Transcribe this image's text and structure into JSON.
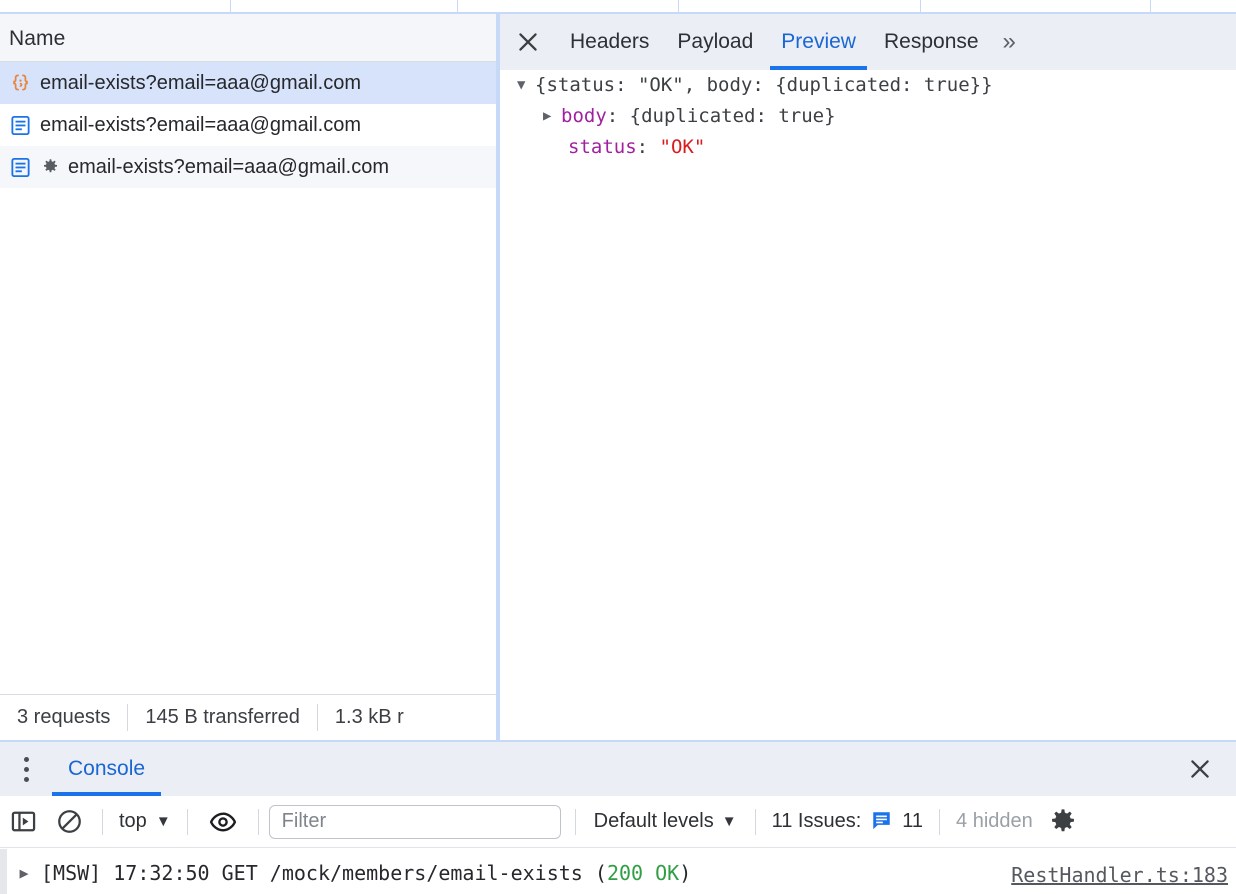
{
  "network": {
    "column_header": "Name",
    "requests": [
      {
        "icon": "json-braces-icon",
        "name": "email-exists?email=aaa@gmail.com",
        "selected": true,
        "has_gear": false
      },
      {
        "icon": "document-icon",
        "name": "email-exists?email=aaa@gmail.com",
        "selected": false,
        "has_gear": false
      },
      {
        "icon": "document-icon",
        "name": "email-exists?email=aaa@gmail.com",
        "selected": false,
        "has_gear": true
      }
    ],
    "status_bar": {
      "requests": "3 requests",
      "transferred": "145 B transferred",
      "resources": "1.3 kB r"
    }
  },
  "detail": {
    "close_icon": "close-icon",
    "tabs": [
      {
        "label": "Headers",
        "active": false
      },
      {
        "label": "Payload",
        "active": false
      },
      {
        "label": "Preview",
        "active": true
      },
      {
        "label": "Response",
        "active": false
      }
    ],
    "overflow": "»",
    "preview": {
      "line1": {
        "triangle": "▼",
        "text": "{status: \"OK\", body: {duplicated: true}}"
      },
      "line2": {
        "triangle": "▶",
        "key": "body",
        "sep": ": ",
        "value": "{duplicated: true}"
      },
      "line3": {
        "key": "status",
        "sep": ": ",
        "value": "\"OK\""
      }
    }
  },
  "console": {
    "menu_icon": "kebab-menu-icon",
    "tab_label": "Console",
    "close_icon": "close-icon",
    "toolbar": {
      "sidebar_icon": "sidebar-toggle-icon",
      "clear_icon": "clear-console-icon",
      "context": "top",
      "context_caret": "▼",
      "eye_icon": "live-expression-eye-icon",
      "filter_placeholder": "Filter",
      "levels_label": "Default levels",
      "levels_caret": "▼",
      "issues_label": "11 Issues:",
      "issues_icon": "issues-message-icon",
      "issues_count": "11",
      "hidden_label": "4 hidden",
      "settings_icon": "gear-icon"
    },
    "message": {
      "triangle": "▶",
      "prefix": "[MSW] 17:32:50 GET /mock/members/email-exists (",
      "status": "200 OK",
      "suffix": ")",
      "source": "RestHandler.ts:183"
    }
  },
  "colors": {
    "accent_blue": "#1a73e8",
    "selection_blue": "#d6e3fa",
    "panel_gray": "#eceef6",
    "json_orange": "#e8843c",
    "doc_blue": "#1a73e8",
    "string_red": "#d81b1b",
    "key_purple": "#a020a0",
    "status_green": "#2f9e44"
  }
}
